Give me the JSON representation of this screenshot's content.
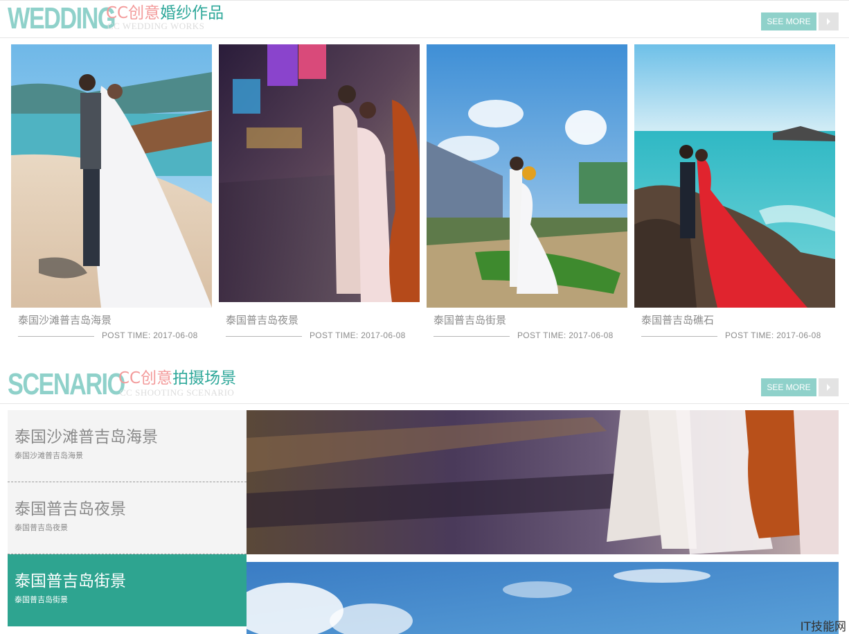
{
  "wedding": {
    "title_en": "WEDDING",
    "title_cn_pink": "CC创意",
    "title_cn_teal": "婚纱作品",
    "subtitle_en": "CC WEDDING WORKS",
    "see_more_label": "SEE MORE",
    "arrow_icon": "chevron-right-icon",
    "cards": [
      {
        "title": "泰国沙滩普吉岛海景",
        "post_time": "POST TIME: 2017-06-08",
        "image": "beach-couple-photo"
      },
      {
        "title": "泰国普吉岛夜景",
        "post_time": "POST TIME: 2017-06-08",
        "image": "night-street-couple-photo"
      },
      {
        "title": "泰国普吉岛街景",
        "post_time": "POST TIME: 2017-06-08",
        "image": "street-scene-couple-photo"
      },
      {
        "title": "泰国普吉岛礁石",
        "post_time": "POST TIME: 2017-06-08",
        "image": "rocks-red-dress-couple-photo"
      }
    ]
  },
  "scenario": {
    "title_en": "SCENARIO",
    "title_cn_pink": "CC创意",
    "title_cn_teal": "拍摄场景",
    "subtitle_en": "CC SHOOTING SCENARIO",
    "see_more_label": "SEE MORE",
    "items": [
      {
        "title": "泰国沙滩普吉岛海景",
        "subtitle": "泰国沙滩普吉岛海景",
        "active": false
      },
      {
        "title": "泰国普吉岛夜景",
        "subtitle": "泰国普吉岛夜景",
        "active": false
      },
      {
        "title": "泰国普吉岛街景",
        "subtitle": "泰国普吉岛街景",
        "active": true
      }
    ]
  },
  "watermark": "IT技能网",
  "colors": {
    "accent": "#8fd1ca",
    "active": "#2ea490",
    "pink": "#f39b9b",
    "teal_text": "#2fa89a"
  }
}
